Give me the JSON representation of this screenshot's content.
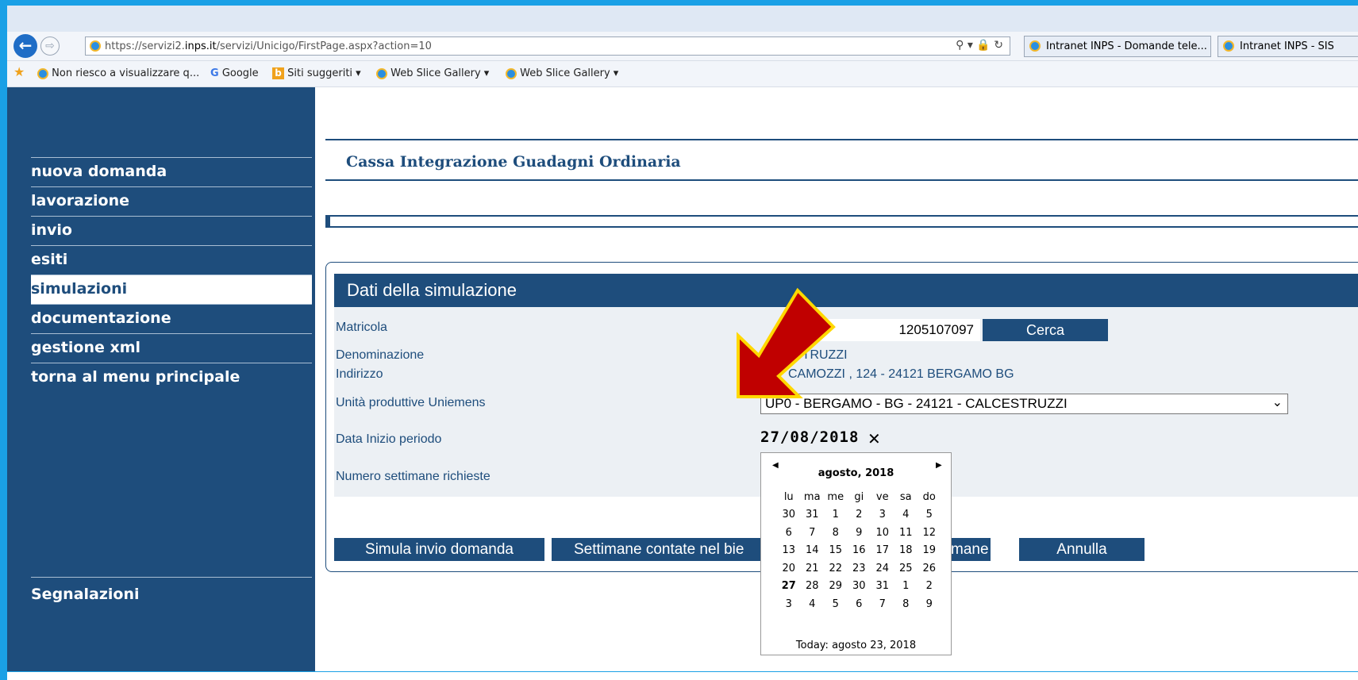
{
  "browser": {
    "url_prefix": "https://servizi2.",
    "url_domain": "inps.it",
    "url_suffix": "/servizi/Unicigo/FirstPage.aspx?action=10",
    "tabs": [
      {
        "title": "Intranet INPS - Domande tele..."
      },
      {
        "title": "Intranet INPS - SIS"
      }
    ],
    "favorites": [
      {
        "label": "Non riesco a visualizzare q..."
      },
      {
        "label": "Google"
      },
      {
        "label": "Siti suggeriti ▾"
      },
      {
        "label": "Web Slice Gallery ▾"
      },
      {
        "label": "Web Slice Gallery ▾"
      }
    ]
  },
  "sidebar": {
    "items": [
      {
        "label": "nuova domanda"
      },
      {
        "label": "lavorazione"
      },
      {
        "label": "invio"
      },
      {
        "label": "esiti"
      },
      {
        "label": "simulazioni"
      },
      {
        "label": "documentazione"
      },
      {
        "label": "gestione xml"
      },
      {
        "label": "torna al menu principale"
      }
    ],
    "active": "simulazioni",
    "footer": "Segnalazioni"
  },
  "page": {
    "title": "Cassa Integrazione Guadagni Ordinaria"
  },
  "panel": {
    "title": "Dati della simulazione",
    "fields": {
      "matricola_label": "Matricola",
      "matricola_value": "1205107097",
      "cerca": "Cerca",
      "denominazione_label": "Denominazione",
      "denominazione_value": "STRUZZI",
      "indirizzo_label": "Indirizzo",
      "indirizzo_value": "CAMOZZI , 124 - 24121 BERGAMO BG",
      "unita_label": "Unità produttive Uniemens",
      "unita_value": "UP0 - BERGAMO - BG - 24121 - CALCESTRUZZI",
      "data_label": "Data Inizio periodo",
      "data_value": "27/08/2018",
      "settimane_label": "Numero settimane richieste"
    },
    "buttons": {
      "simula": "Simula invio domanda",
      "settimane": "Settimane contate nel bie",
      "settimane_tail": "mane",
      "annulla": "Annulla"
    }
  },
  "calendar": {
    "month": "agosto, 2018",
    "weekdays": [
      "lu",
      "ma",
      "me",
      "gi",
      "ve",
      "sa",
      "do"
    ],
    "weeks": [
      [
        "30",
        "31",
        "1",
        "2",
        "3",
        "4",
        "5"
      ],
      [
        "6",
        "7",
        "8",
        "9",
        "10",
        "11",
        "12"
      ],
      [
        "13",
        "14",
        "15",
        "16",
        "17",
        "18",
        "19"
      ],
      [
        "20",
        "21",
        "22",
        "23",
        "24",
        "25",
        "26"
      ],
      [
        "27",
        "28",
        "29",
        "30",
        "31",
        "1",
        "2"
      ],
      [
        "3",
        "4",
        "5",
        "6",
        "7",
        "8",
        "9"
      ]
    ],
    "selected": "27",
    "today": "Today: agosto 23, 2018"
  },
  "colors": {
    "brand": "#1e4d7c",
    "highlight_arrow": "#c00000",
    "arrow_outline": "#ffd800"
  }
}
